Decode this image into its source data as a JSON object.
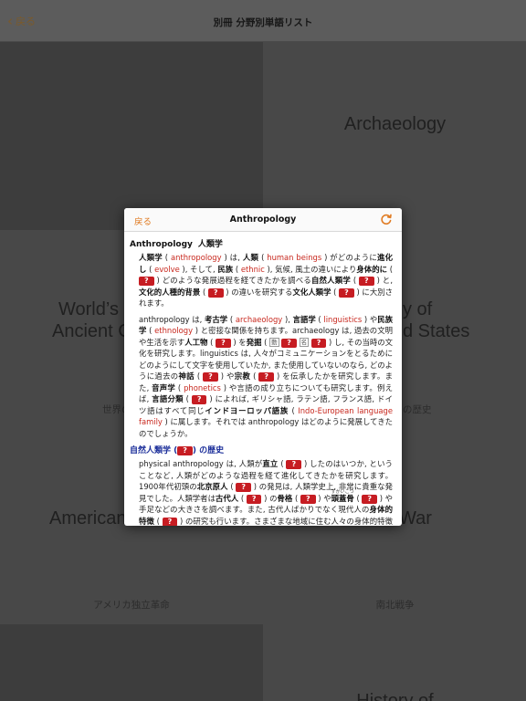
{
  "navbar": {
    "back_label": "戻る",
    "title": "別冊 分野別単語リスト"
  },
  "tiles": [
    {
      "title": "",
      "sub": ""
    },
    {
      "title": "Archaeology",
      "sub": ""
    },
    {
      "title": "World’s ...",
      "title_visible": "World’s",
      "title2": "Ancient C...",
      "title2_visible": "Ancient C",
      "sub": "世界の..."
    },
    {
      "title": "...y of",
      "title_visible": "y of",
      "title2": "...d States",
      "title2_visible": "d States",
      "sub": "...の歴史"
    },
    {
      "title": "American",
      "sub": "アメリカ独立革命"
    },
    {
      "title": "War",
      "sub": "南北戦争"
    },
    {
      "title": "",
      "sub": ""
    },
    {
      "title": "History of",
      "sub": ""
    }
  ],
  "popup": {
    "back_label": "戻る",
    "title": "Anthropology",
    "section1": {
      "en": "Anthropology",
      "jp": "人類学"
    },
    "section2_heading_pre": "自然人類学 (",
    "section2_heading_post": ") の歴史",
    "blank_label": "?",
    "ruby_text": "ずがいこつ",
    "box_label": "動",
    "box_label2": "名",
    "p1": {
      "t1": "人類学",
      "t2": " ( ",
      "r1": "anthropology",
      "t3": " ) は, ",
      "b1": "人類",
      "t4": " ( ",
      "r2": "human beings",
      "t5": " ) がどのように",
      "b2": "進化し",
      "t6": " ( ",
      "r3": "evolve",
      "t7": " ), そして, ",
      "b3": "民族",
      "t8": " ( ",
      "r4": "ethnic",
      "t9": " ), 気候, 風土の違いにより",
      "b4": "身体的に",
      "t10": " ( ",
      "t11": " ) どのような発展過程を経てきたかを調べる",
      "b5": "自然人類学",
      "t12": " ( ",
      "t13": " ) と, ",
      "b6": "文化的人種的背景",
      "t14": " ( ",
      "t15": " ) の違いを研究する",
      "b7": "文化人類学",
      "t16": " ( ",
      "t17": " ) に大別されます。"
    },
    "p2": {
      "t1": "anthropology は, ",
      "b1": "考古学",
      "t2": " ( ",
      "r1": "archaeology",
      "t3": " ), ",
      "b2": "言語学",
      "t4": " ( ",
      "r2": "linguistics",
      "t5": " ) や",
      "b3": "民族学",
      "t6": " ( ",
      "r3": "ethnology",
      "t7": " ) と密接な関係を持ちます。archaeology は, 過去の文明や生活を示す",
      "b4": "人工物",
      "t8": " ( ",
      "t9": " ) を",
      "b5": "発掘",
      "t10": " ( ",
      "t11": " ) し, その当時の文化を研究します。linguistics は, 人々がコミュニケーションをとるためにどのようにして文字を使用していたか, また使用していないのなら, どのように過去の",
      "b6": "神話",
      "t12": " ( ",
      "t13": " ) や",
      "b7": "宗教",
      "t14": " ( ",
      "t15": " ) を伝承したかを研究します。また, ",
      "b8": "音声学",
      "t16": " ( ",
      "r4": "phonetics",
      "t17": " ) や言語の成り立ちについても研究します。例えば, ",
      "b9": "言語分類",
      "t18": " ( ",
      "t19": " ) によれば, ギリシャ語, ラテン語, フランス語, ドイツ語はすべて同じ",
      "b10": "インドヨーロッパ語族",
      "t20": " ( ",
      "r5": "Indo-European language family",
      "t21": " ) に属します。それでは anthropology はどのように発展してきたのでしょうか。"
    },
    "p3": {
      "t1": "physical anthropology は, 人類が",
      "b1": "直立",
      "t2": " ( ",
      "t3": " ) したのはいつか, ということなど, 人類がどのような過程を経て進化してきたかを研究します。1900年代初頭の",
      "b2": "北京原人",
      "t4": " ( ",
      "t5": " ) の発見は, 人類学史上, 非常に貴重な発見でした。人類学者は",
      "b3": "古代人",
      "t6": " ( ",
      "t7": " ) の",
      "b4": "骨格",
      "t8": " ( ",
      "t9": " ) や",
      "b5": "頭蓋骨",
      "t10": " ( ",
      "t11": " ) や手足などの大きさを調べます。また, 古代人ばかりでなく現代人の",
      "b6": "身体的特徴",
      "t12": " ( ",
      "t13": " ) の研究も行います。さまざまな地域に住む人々の身体的特徴を比較することで, 人種の違いや移動経路などを明らかにします。"
    }
  }
}
